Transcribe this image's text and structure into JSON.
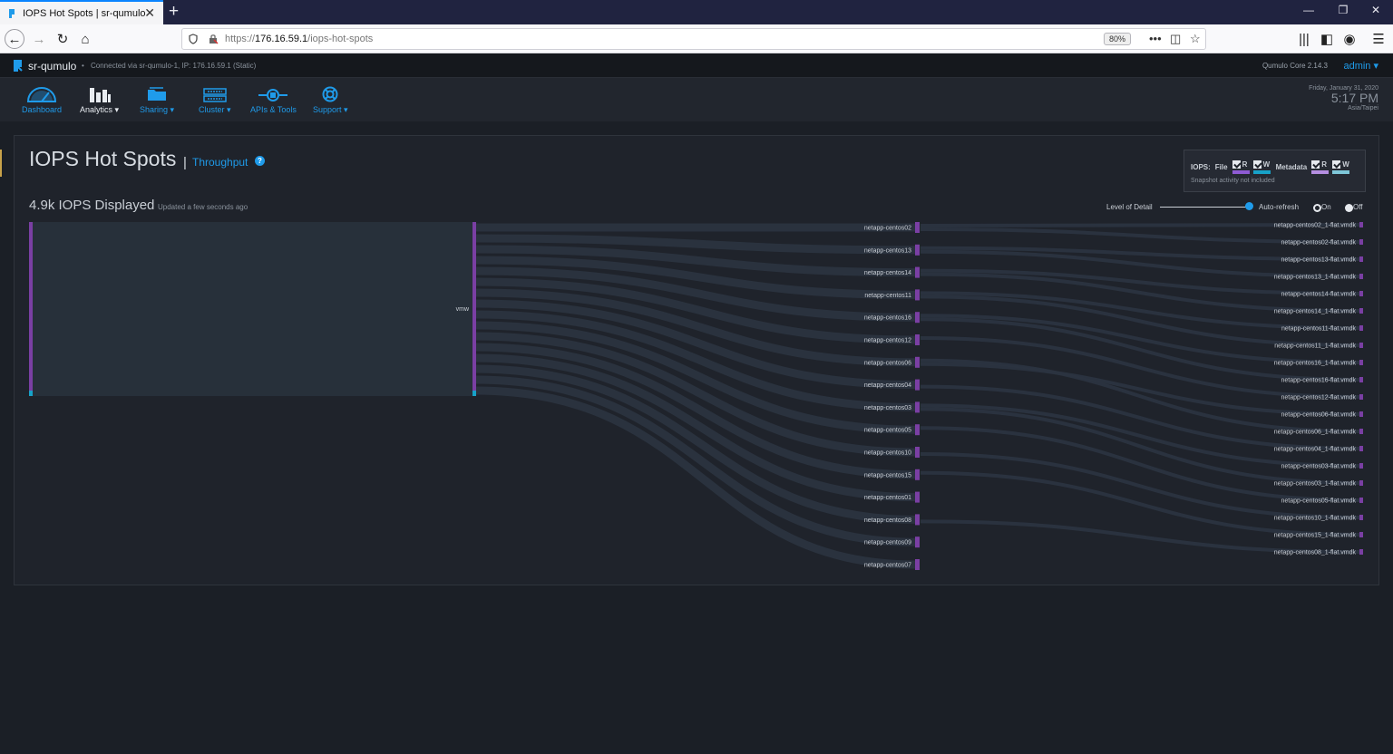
{
  "browser": {
    "tab_title": "IOPS Hot Spots | sr-qumulo",
    "url_prefix": "https://",
    "url_host": "176.16.59.1",
    "url_path": "/iops-hot-spots",
    "zoom": "80%"
  },
  "app": {
    "brand": "sr-qumulo",
    "connection": "Connected via sr-qumulo-1, IP: 176.16.59.1 (Static)",
    "version": "Qumulo Core 2.14.3",
    "user": "admin",
    "nav": [
      {
        "label": "Dashboard"
      },
      {
        "label": "Analytics ▾"
      },
      {
        "label": "Sharing ▾"
      },
      {
        "label": "Cluster ▾"
      },
      {
        "label": "APIs & Tools"
      },
      {
        "label": "Support ▾"
      }
    ],
    "date": "Friday, January 31, 2020",
    "time": "5:17 PM",
    "timezone": "Asia/Taipei"
  },
  "page": {
    "title": "IOPS Hot Spots",
    "separator": "|",
    "throughput_link": "Throughput",
    "help": "?",
    "iops_displayed": "4.9k IOPS Displayed",
    "updated": "Updated a few seconds ago",
    "legend": {
      "iops_label": "IOPS:",
      "file_label": "File",
      "metadata_label": "Metadata",
      "r": "R",
      "w": "W",
      "note": "Snapshot activity not included",
      "colors": {
        "file_r": "#8e5bd4",
        "file_w": "#17a2c8",
        "meta_r": "#b48ee0",
        "meta_w": "#7ec6d8"
      }
    },
    "level_of_detail": "Level of Detail",
    "level_of_detail_value": 1.0,
    "auto_refresh": "Auto-refresh",
    "on": "On",
    "off": "Off"
  },
  "hotspots": {
    "root": "vmw",
    "hosts": [
      "netapp-centos02",
      "netapp-centos13",
      "netapp-centos14",
      "netapp-centos11",
      "netapp-centos16",
      "netapp-centos12",
      "netapp-centos06",
      "netapp-centos04",
      "netapp-centos03",
      "netapp-centos05",
      "netapp-centos10",
      "netapp-centos15",
      "netapp-centos01",
      "netapp-centos08",
      "netapp-centos09",
      "netapp-centos07"
    ],
    "files": [
      "netapp-centos02_1-flat.vmdk",
      "netapp-centos02-flat.vmdk",
      "netapp-centos13-flat.vmdk",
      "netapp-centos13_1-flat.vmdk",
      "netapp-centos14-flat.vmdk",
      "netapp-centos14_1-flat.vmdk",
      "netapp-centos11-flat.vmdk",
      "netapp-centos11_1-flat.vmdk",
      "netapp-centos16_1-flat.vmdk",
      "netapp-centos16-flat.vmdk",
      "netapp-centos12-flat.vmdk",
      "netapp-centos06-flat.vmdk",
      "netapp-centos06_1-flat.vmdk",
      "netapp-centos04_1-flat.vmdk",
      "netapp-centos03-flat.vmdk",
      "netapp-centos03_1-flat.vmdk",
      "netapp-centos05-flat.vmdk",
      "netapp-centos10_1-flat.vmdk",
      "netapp-centos15_1-flat.vmdk",
      "netapp-centos08_1-flat.vmdk"
    ],
    "colors": {
      "node": "#7a3fa3",
      "flow": "#2b3440",
      "root_fill": "#27303a",
      "write": "#17a2c8"
    }
  }
}
